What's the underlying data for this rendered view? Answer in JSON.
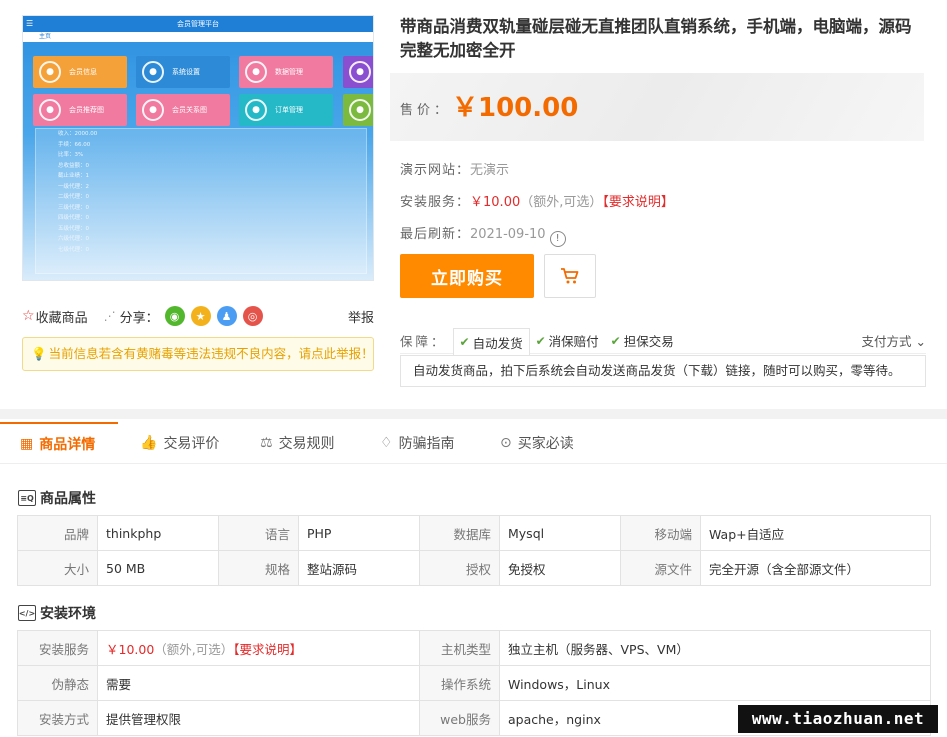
{
  "preview": {
    "app_title": "会员管理平台",
    "sub_nav": "主页",
    "tiles": [
      {
        "label": "会员信息",
        "color": "#f5a13a"
      },
      {
        "label": "系统设置",
        "color": "#2d8ad6"
      },
      {
        "label": "数据管理",
        "color": "#f07aa0"
      },
      {
        "label": "",
        "color": "#8a4fd1"
      },
      {
        "label": "会员推荐图",
        "color": "#f07aa0"
      },
      {
        "label": "会员关系图",
        "color": "#f07aa0"
      },
      {
        "label": "订单管理",
        "color": "#25b9c8"
      },
      {
        "label": "",
        "color": "#7bb93f"
      }
    ],
    "stat_lines": [
      "收入：2000.00",
      "手续：66.00",
      "比率：3%",
      "总收益额：0",
      "截止业绩：1",
      "一级代理：2",
      "二级代理：0",
      "三级代理：0",
      "四级代理：0",
      "五级代理：0",
      "六级代理：0",
      "七级代理：0"
    ]
  },
  "actions": {
    "favorite": "收藏商品",
    "share": "分享：",
    "report": "举报",
    "warning": "当前信息若含有黄赌毒等违法违规不良内容，请点此举报！"
  },
  "product": {
    "title": "带商品消费双轨量碰层碰无直推团队直销系统，手机端，电脑端，源码完整无加密全开",
    "price_label": "售价：",
    "price": "￥100.00",
    "demo_label": "演示网站：",
    "demo_value": "无演示",
    "install_label": "安装服务：",
    "install_price": "￥10.00",
    "install_note": "（额外,可选）",
    "install_req": "【要求说明】",
    "refresh_label": "最后刷新：",
    "refresh_date": "2021-09-10",
    "buy_label": "立即购买",
    "guarantee_label": "保障：",
    "guarantees": [
      "自动发货",
      "消保赔付",
      "担保交易"
    ],
    "pay_methods": "支付方式",
    "guarantee_desc": "自动发货商品，拍下后系统会自动发送商品发货（下载）链接，随时可以购买，零等待。"
  },
  "tabs": [
    "商品详情",
    "交易评价",
    "交易规则",
    "防骗指南",
    "买家必读"
  ],
  "attributes": {
    "title": "商品属性",
    "rows": [
      [
        [
          "品牌",
          "thinkphp"
        ],
        [
          "语言",
          "PHP"
        ],
        [
          "数据库",
          "Mysql"
        ],
        [
          "移动端",
          "Wap+自适应"
        ]
      ],
      [
        [
          "大小",
          "50 MB"
        ],
        [
          "规格",
          "整站源码"
        ],
        [
          "授权",
          "免授权"
        ],
        [
          "源文件",
          "完全开源（含全部源文件）"
        ]
      ]
    ]
  },
  "environment": {
    "title": "安装环境",
    "install_service_label": "安装服务",
    "install_price": "￥10.00",
    "install_note": "（额外,可选）",
    "install_req": "【要求说明】",
    "host_label": "主机类型",
    "host_value": "独立主机（服务器、VPS、VM）",
    "rewrite_label": "伪静态",
    "rewrite_value": "需要",
    "os_label": "操作系统",
    "os_value": "Windows，Linux",
    "method_label": "安装方式",
    "method_value": "提供管理权限",
    "web_label": "web服务",
    "web_value": "apache，nginx"
  },
  "watermark": "www.tiaozhuan.net"
}
